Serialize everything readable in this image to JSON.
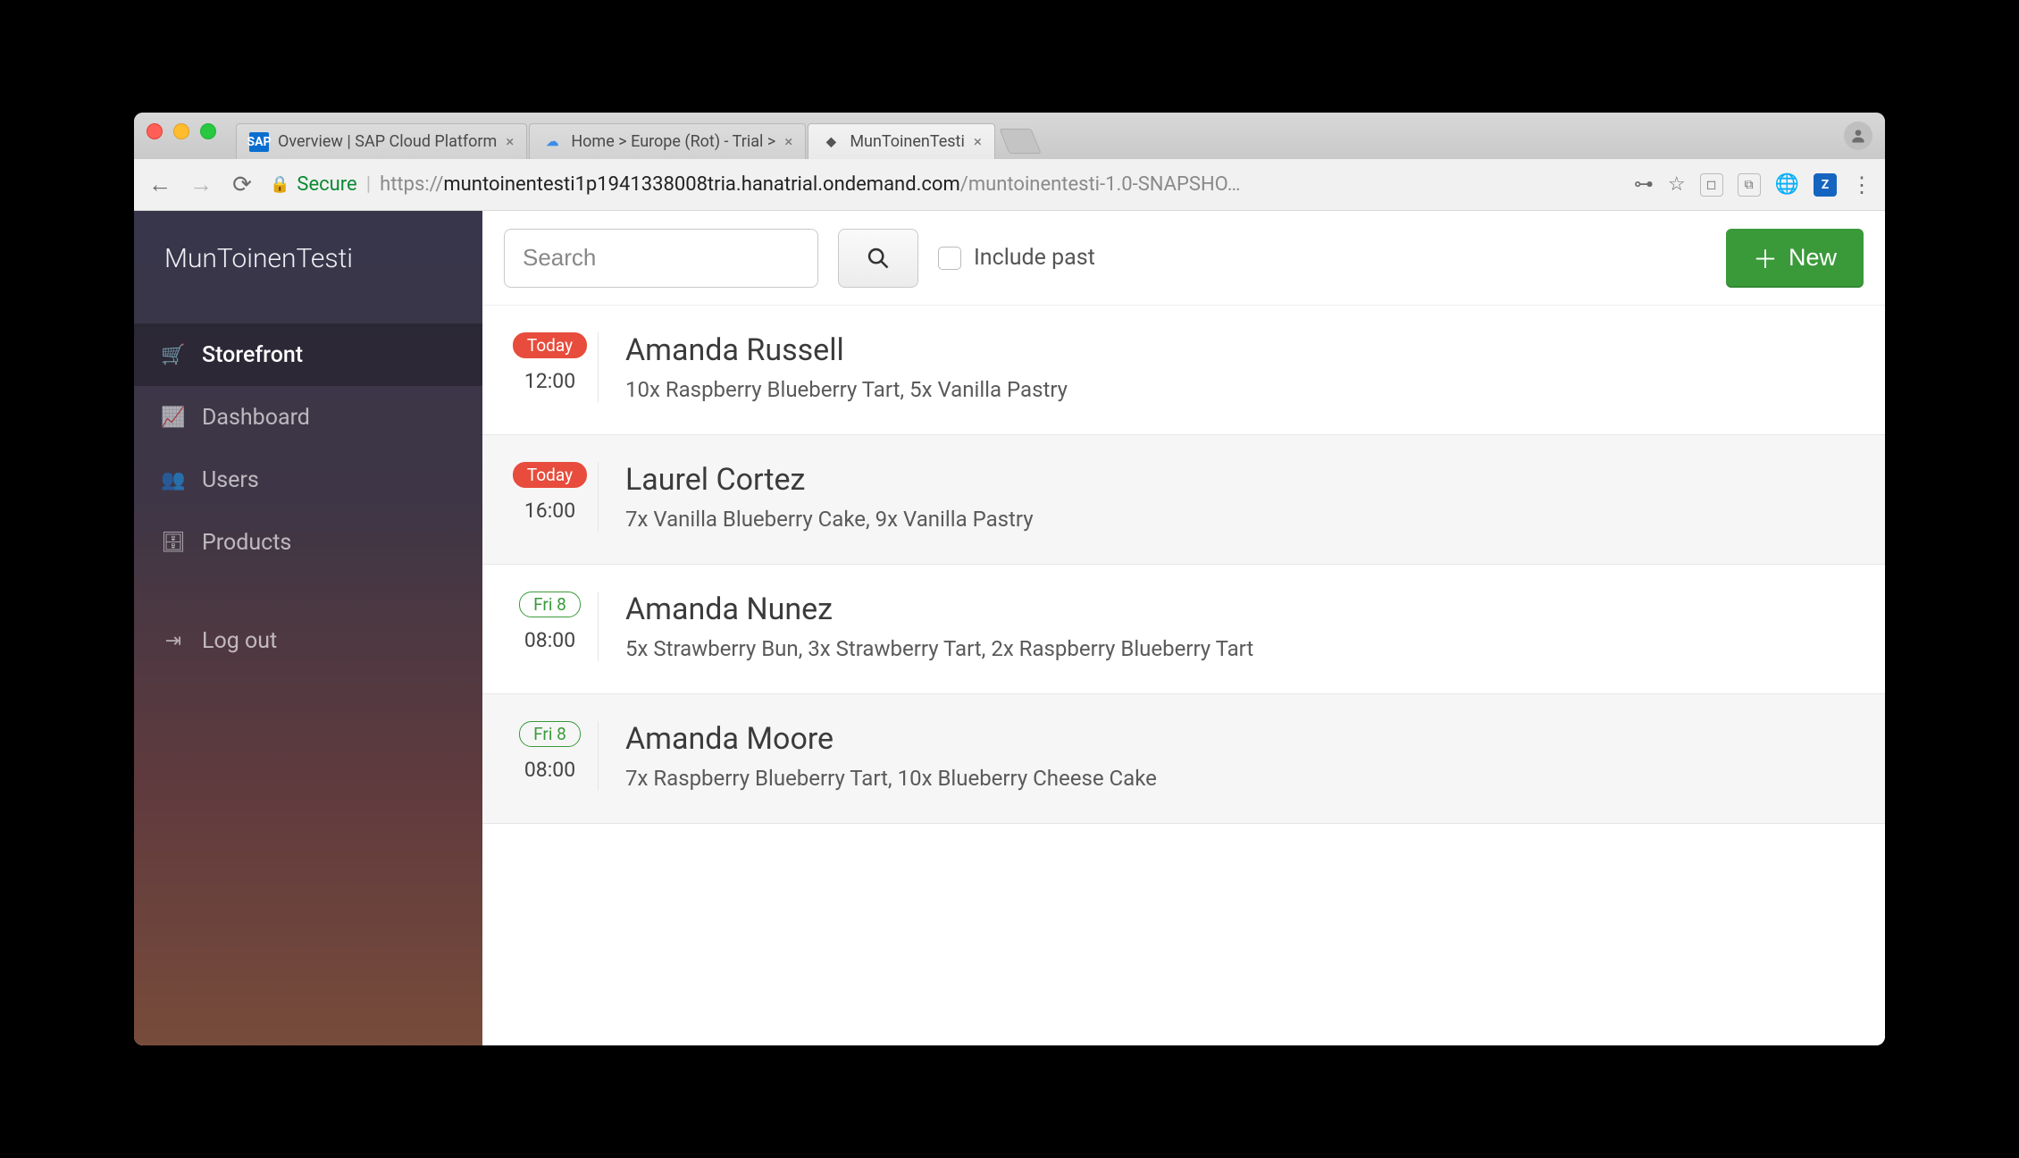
{
  "browser": {
    "tabs": [
      {
        "favicon": "sap",
        "title": "Overview | SAP Cloud Platform"
      },
      {
        "favicon": "cloud",
        "title": "Home > Europe (Rot) - Trial >"
      },
      {
        "favicon": "cube",
        "title": "MunToinenTesti"
      }
    ],
    "secure_label": "Secure",
    "url_protocol": "https://",
    "url_host": "muntoinentesti1p1941338008tria.hanatrial.ondemand.com",
    "url_path": "/muntoinentesti-1.0-SNAPSHO…"
  },
  "app": {
    "brand": "MunToinenTesti",
    "sidebar": {
      "items": [
        {
          "icon": "cart",
          "label": "Storefront",
          "active": true
        },
        {
          "icon": "chart",
          "label": "Dashboard",
          "active": false
        },
        {
          "icon": "users",
          "label": "Users",
          "active": false
        },
        {
          "icon": "box",
          "label": "Products",
          "active": false
        }
      ],
      "logout_label": "Log out"
    },
    "topbar": {
      "search_placeholder": "Search",
      "include_past_label": "Include past",
      "new_label": "New"
    },
    "orders": [
      {
        "badge": "Today",
        "badge_kind": "today",
        "time": "12:00",
        "name": "Amanda Russell",
        "desc": "10x Raspberry Blueberry Tart, 5x Vanilla Pastry",
        "alt": false
      },
      {
        "badge": "Today",
        "badge_kind": "today",
        "time": "16:00",
        "name": "Laurel Cortez",
        "desc": "7x Vanilla Blueberry Cake, 9x Vanilla Pastry",
        "alt": true
      },
      {
        "badge": "Fri 8",
        "badge_kind": "date",
        "time": "08:00",
        "name": "Amanda Nunez",
        "desc": "5x Strawberry Bun, 3x Strawberry Tart, 2x Raspberry Blueberry Tart",
        "alt": false
      },
      {
        "badge": "Fri 8",
        "badge_kind": "date",
        "time": "08:00",
        "name": "Amanda Moore",
        "desc": "7x Raspberry Blueberry Tart, 10x Blueberry Cheese Cake",
        "alt": true
      }
    ]
  }
}
